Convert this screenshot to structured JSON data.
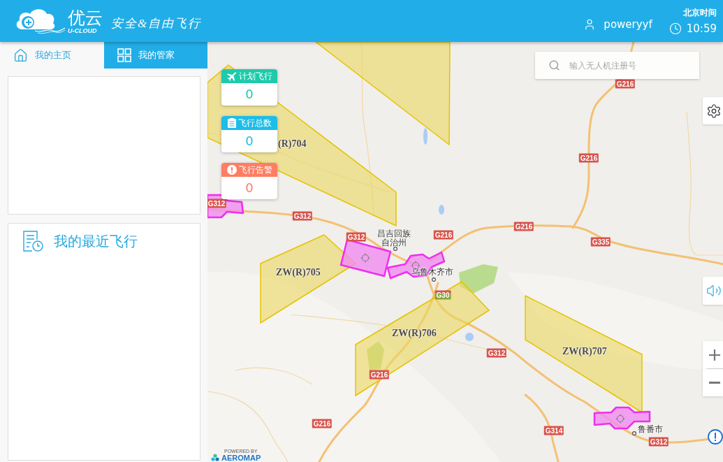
{
  "header": {
    "brand": "优云",
    "brand_sub": "U-CLOUD",
    "slogan": "安全&自由飞行",
    "username": "poweryyf",
    "time_label": "北京时间",
    "time": "10:59"
  },
  "sidebar": {
    "tabs": [
      {
        "label": "我的主页",
        "kind": "home",
        "selected": false
      },
      {
        "label": "我的管家",
        "kind": "grid",
        "selected": true
      }
    ],
    "recent_flights": {
      "title": "我的最近飞行"
    }
  },
  "map": {
    "search": {
      "placeholder": "输入无人机注册号"
    },
    "stats": [
      {
        "kind": "planned",
        "label": "计划飞行",
        "value": "0",
        "color": "#1dcbab"
      },
      {
        "kind": "total",
        "label": "飞行总数",
        "value": "0",
        "color": "#1dbde8"
      },
      {
        "kind": "alert",
        "label": "飞行告警",
        "value": "0",
        "color": "#fe7d63"
      }
    ],
    "zone_labels": [
      "(R)704",
      "ZW(R)705",
      "ZW(R)706",
      "ZW(R)707"
    ],
    "place_labels": [
      "昌吉回族自治州",
      "乌鲁木齐市",
      "鲁番市"
    ],
    "road_shields": [
      {
        "label": "G216",
        "kind": "national"
      },
      {
        "label": "G216",
        "kind": "national"
      },
      {
        "label": "G312",
        "kind": "national"
      },
      {
        "label": "G312",
        "kind": "national"
      },
      {
        "label": "G312",
        "kind": "national"
      },
      {
        "label": "G216",
        "kind": "national"
      },
      {
        "label": "G216",
        "kind": "national"
      },
      {
        "label": "G335",
        "kind": "national"
      },
      {
        "label": "G30",
        "kind": "expressway"
      },
      {
        "label": "G312",
        "kind": "national"
      },
      {
        "label": "G216",
        "kind": "national"
      },
      {
        "label": "G216",
        "kind": "national"
      },
      {
        "label": "G314",
        "kind": "national"
      },
      {
        "label": "G312",
        "kind": "national"
      }
    ],
    "attribution": {
      "caption": "POWERED BY",
      "brand": "AEROMAP"
    }
  }
}
